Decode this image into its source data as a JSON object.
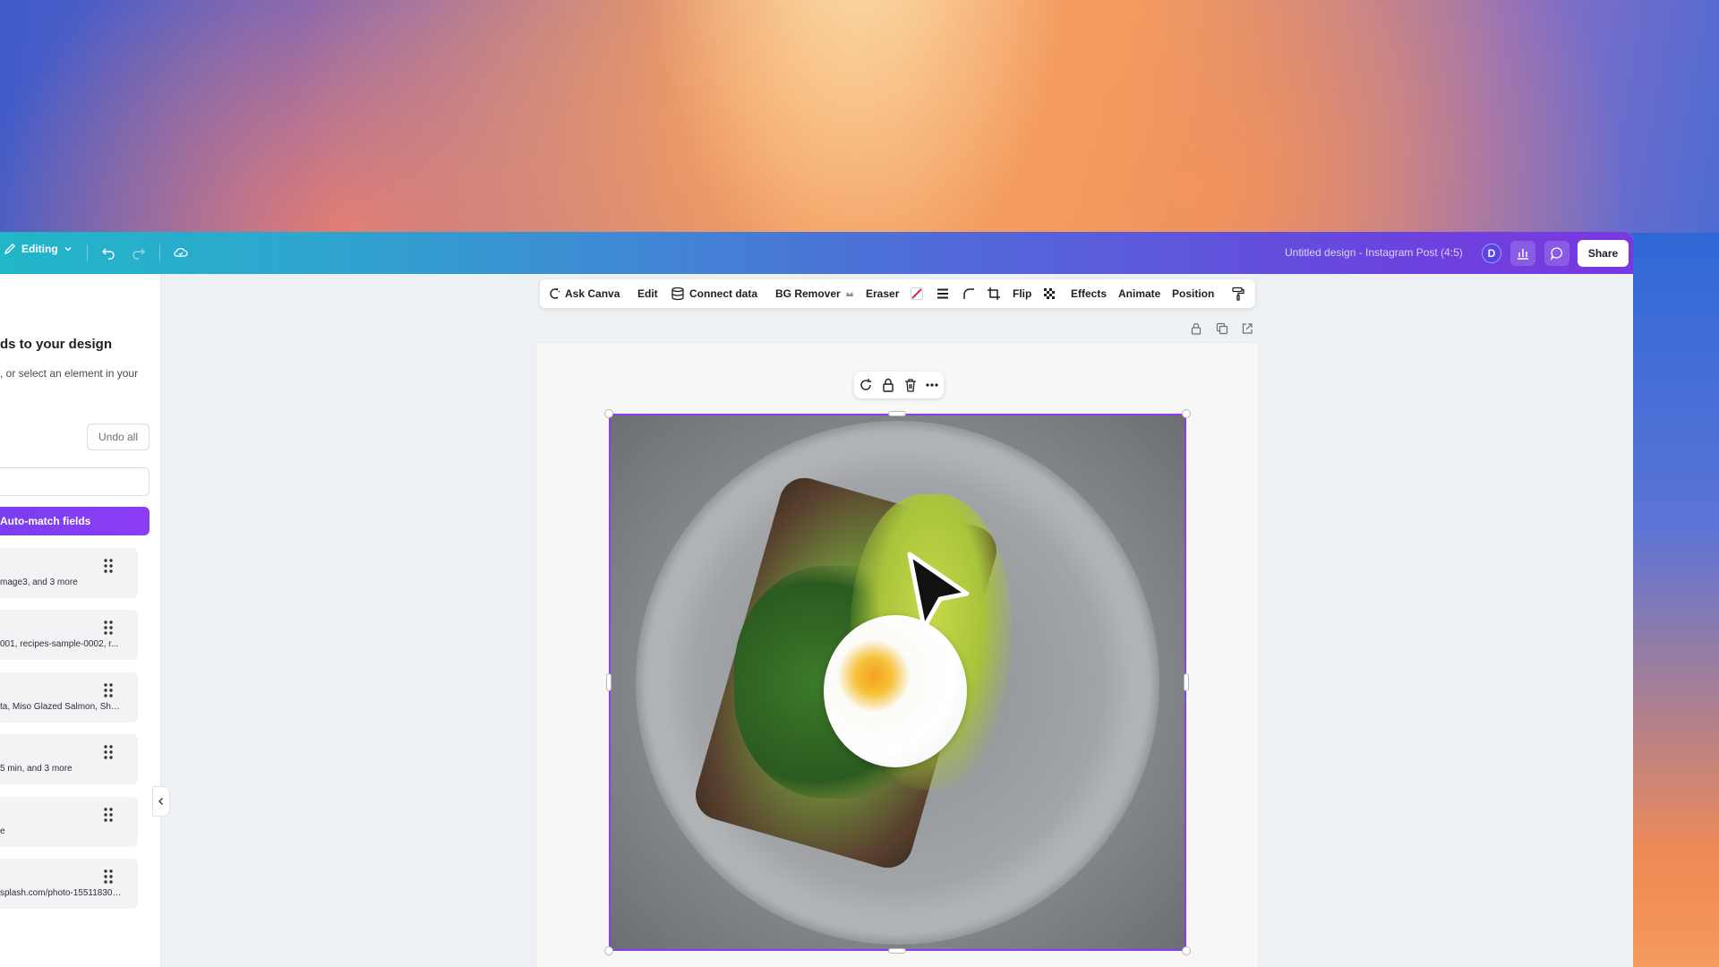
{
  "topbar": {
    "mode_label": "Editing",
    "doc_title": "Untitled design - Instagram Post (4:5)",
    "avatar_initial": "D",
    "share_label": "Share"
  },
  "sidepanel": {
    "title": "ds to your design",
    "subtitle": ", or select an element in your",
    "undo_all_label": "Undo all",
    "input_value": "",
    "auto_match_label": "Auto-match fields",
    "fields": [
      {
        "text": "mage3, and 3 more"
      },
      {
        "text": "001, recipes-sample-0002, r..."
      },
      {
        "text": "ta, Miso Glazed Salmon, Shee..."
      },
      {
        "text": "5 min, and 3 more"
      },
      {
        "text": "e"
      },
      {
        "text": "splash.com/photo-155118305..."
      }
    ]
  },
  "context_toolbar": {
    "ask_canva": "Ask Canva",
    "edit": "Edit",
    "connect_data": "Connect data",
    "bg_remover": "BG Remover",
    "eraser": "Eraser",
    "flip": "Flip",
    "effects": "Effects",
    "animate": "Animate",
    "position": "Position"
  },
  "colors": {
    "accent": "#8b3df2",
    "topbar_start": "#21b6c8",
    "topbar_end": "#7a38e0"
  },
  "icons": {
    "pen": "pencil-icon",
    "undo": "undo-icon",
    "redo": "redo-icon",
    "cloud": "cloud-icon",
    "chart": "bar-chart-icon",
    "comment": "comment-icon"
  }
}
